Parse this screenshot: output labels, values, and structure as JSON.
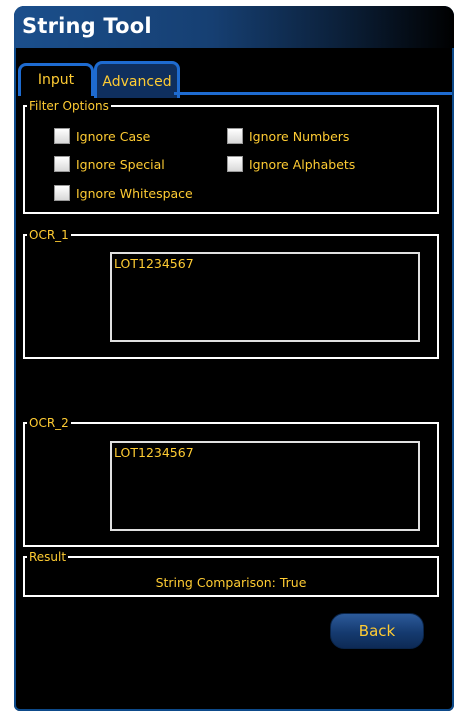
{
  "window": {
    "title": "String Tool"
  },
  "tabs": [
    {
      "label": "Input",
      "active": false
    },
    {
      "label": "Advanced",
      "active": true
    }
  ],
  "filter_options": {
    "legend": "Filter Options",
    "checkboxes": [
      {
        "label": "Ignore Case",
        "checked": false
      },
      {
        "label": "Ignore Numbers",
        "checked": false
      },
      {
        "label": "Ignore Special",
        "checked": false
      },
      {
        "label": "Ignore Alphabets",
        "checked": false
      },
      {
        "label": "Ignore Whitespace",
        "checked": false
      }
    ]
  },
  "ocr1": {
    "legend": "OCR_1",
    "value": "LOT1234567"
  },
  "ocr2": {
    "legend": "OCR_2",
    "value": "LOT1234567"
  },
  "result": {
    "legend": "Result",
    "text": "String Comparison: True"
  },
  "buttons": {
    "back": "Back"
  },
  "colors": {
    "accent_text": "#ffcc33",
    "tab_border": "#1e6bd0",
    "background": "#000000",
    "title_text": "#ffffff"
  }
}
